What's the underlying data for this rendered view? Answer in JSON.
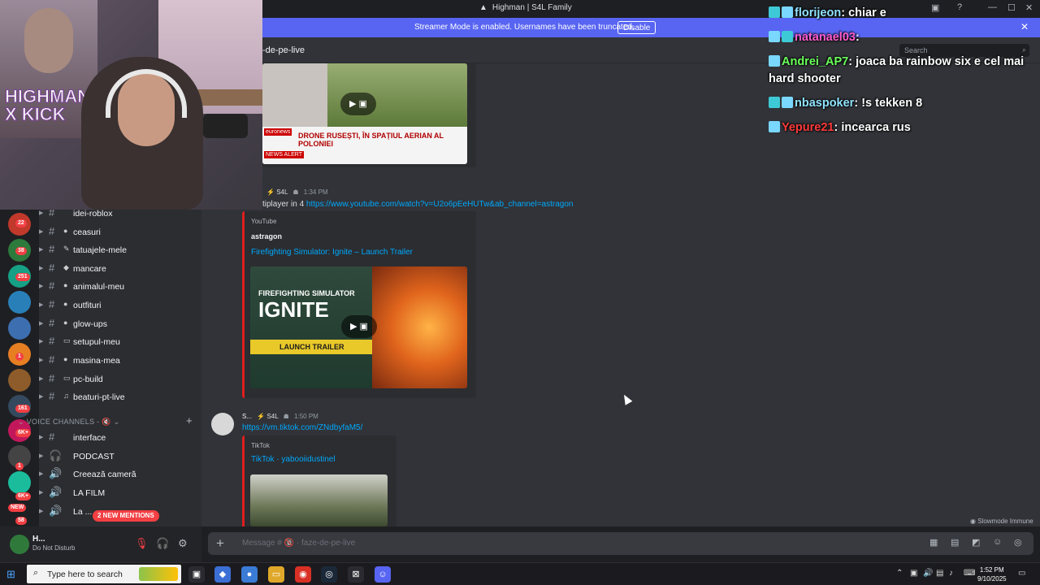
{
  "window": {
    "title": "Highman | S4L Family",
    "controls": [
      "—",
      "☐",
      "✕"
    ]
  },
  "streamer_bar": {
    "message": "Streamer Mode is enabled. Usernames have been truncated.",
    "disable_label": "Disable"
  },
  "channel_header": {
    "name": "-de-pe-live",
    "search_placeholder": "Search"
  },
  "server_badges": [
    "22",
    "38",
    "251",
    "1",
    "161",
    "6K+",
    "1",
    "6K+",
    "NEW",
    "58"
  ],
  "channels": [
    {
      "emoji": "",
      "label": "idei-roblox"
    },
    {
      "emoji": "●",
      "label": "ceasuri"
    },
    {
      "emoji": "✎",
      "label": "tatuajele-mele"
    },
    {
      "emoji": "◆",
      "label": "mancare"
    },
    {
      "emoji": "●",
      "label": "animalul-meu"
    },
    {
      "emoji": "●",
      "label": "outfituri"
    },
    {
      "emoji": "●",
      "label": "glow-ups"
    },
    {
      "emoji": "▭",
      "label": "setupul-meu"
    },
    {
      "emoji": "●",
      "label": "masina-mea"
    },
    {
      "emoji": "▭",
      "label": "pc-build"
    },
    {
      "emoji": "♫",
      "label": "beaturi-pt-live"
    }
  ],
  "voice_category": "VOICE CHANNELS - 🔇",
  "voice_channels": [
    {
      "icon": "#",
      "label": "interface"
    },
    {
      "icon": "🎧",
      "label": "PODCAST"
    },
    {
      "icon": "🔊",
      "label": "Creează cameră"
    },
    {
      "icon": "🔊",
      "label": "LA FILM"
    },
    {
      "icon": "🔊",
      "label": "La ..."
    }
  ],
  "mentions_label": "2 NEW MENTIONS",
  "user_panel": {
    "username": "H...",
    "status": "Do Not Disturb"
  },
  "messages": [
    {
      "time": "1:34 PM",
      "role": "S4L",
      "text_prefix": "tiplayer in 4 ",
      "link": "https://www.youtube.com/watch?v=U2o6pEeHUTw&ab_channel=astragon",
      "embed": {
        "provider": "YouTube",
        "author": "astragon",
        "title": "Firefighting Simulator: Ignite – Launch Trailer",
        "thumb_title_1": "FIREFIGHTING SIMULATOR",
        "thumb_title_2": "IGNITE",
        "thumb_button": "LAUNCH TRAILER"
      }
    },
    {
      "author": "S...",
      "role": "S4L",
      "time": "1:50 PM",
      "link": "https://vm.tiktok.com/ZNdbyfaM5/",
      "embed": {
        "provider": "TikTok",
        "title": "TikTok · yabooiidustinel"
      }
    }
  ],
  "news_thumb": {
    "banner": "DRONE RUSEȘTI, ÎN SPAȚIUL AERIAN AL POLONIEI",
    "ticker": "NEWS ALERT",
    "brand": "euronews"
  },
  "composer": {
    "placeholder": "Message # 🔞 · faze-de-pe-live"
  },
  "slowmode_label": "Slowmode Immune",
  "overlay_chat": [
    {
      "user": "florijeon",
      "text": "chiar e",
      "color": "#8fe3ff"
    },
    {
      "user": "natanael03",
      "text": "",
      "color": "#ff5ccf"
    },
    {
      "user": "Andrei_AP7",
      "text": "joaca ba rainbow six e cel mai hard shooter",
      "color": "#6bff5c"
    },
    {
      "user": "nbaspoker",
      "text": "!s tekken 8",
      "color": "#8fe3ff"
    },
    {
      "user": "Yepure21",
      "text": "incearca rus",
      "color": "#ff3b3b"
    }
  ],
  "webcam_pip_text": "HIGHMAN X KICK",
  "taskbar": {
    "search_placeholder": "Type here to search",
    "time": "1:52 PM",
    "date": "9/10/2025"
  }
}
